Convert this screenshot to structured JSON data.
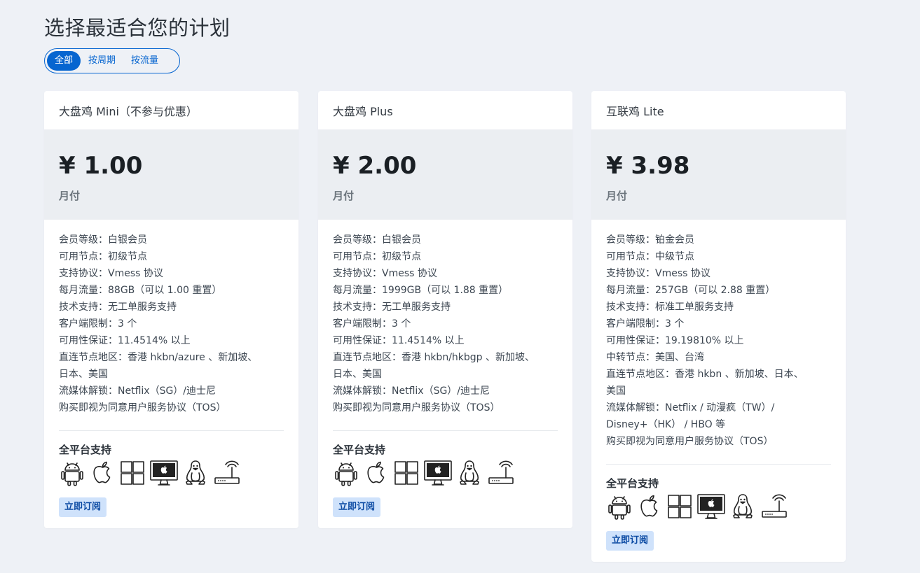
{
  "page": {
    "title": "选择最适合您的计划"
  },
  "filters": [
    {
      "label": "全部",
      "active": true
    },
    {
      "label": "按周期",
      "active": false
    },
    {
      "label": "按流量",
      "active": false
    }
  ],
  "platform_icons": [
    "android-icon",
    "apple-icon",
    "windows-icon",
    "macos-imac-icon",
    "linux-tux-icon",
    "router-icon"
  ],
  "plans": [
    {
      "name": "大盘鸡 Mini（不参与优惠）",
      "price": "¥ 1.00",
      "period": "月付",
      "features": [
        "会员等级：白银会员",
        "可用节点：初级节点",
        "支持协议：Vmess 协议",
        "每月流量：88GB（可以 1.00 重置）",
        "技术支持：无工单服务支持",
        "客户端限制：3 个",
        "可用性保证：11.4514% 以上",
        "直连节点地区：香港 hkbn/azure 、新加坡、",
        "日本、美国",
        "流媒体解锁：Netflix（SG）/迪士尼",
        "购买即视为同意用户服务协议（TOS）"
      ],
      "platform_title": "全平台支持",
      "subscribe_label": "立即订阅"
    },
    {
      "name": "大盘鸡 Plus",
      "price": "¥ 2.00",
      "period": "月付",
      "features": [
        "会员等级：白银会员",
        "可用节点：初级节点",
        "支持协议：Vmess 协议",
        "每月流量：1999GB（可以 1.88 重置）",
        "技术支持：无工单服务支持",
        "客户端限制：3 个",
        "可用性保证：11.4514% 以上",
        "直连节点地区：香港 hkbn/hkbgp 、新加坡、",
        "日本、美国",
        "流媒体解锁：Netflix（SG）/迪士尼",
        "购买即视为同意用户服务协议（TOS）"
      ],
      "platform_title": "全平台支持",
      "subscribe_label": "立即订阅"
    },
    {
      "name": "互联鸡 Lite",
      "price": "¥ 3.98",
      "period": "月付",
      "features": [
        "会员等级：铂金会员",
        "可用节点：中级节点",
        "支持协议：Vmess 协议",
        "每月流量：257GB（可以 2.88 重置）",
        "技术支持：标准工单服务支持",
        "客户端限制：3 个",
        "可用性保证：19.19810% 以上",
        "中转节点：美国、台湾",
        "直连节点地区：香港 hkbn 、新加坡、日本、",
        "美国",
        "流媒体解锁：Netflix / 动漫疯（TW）/",
        "Disney+（HK） / HBO 等",
        "购买即视为同意用户服务协议（TOS）"
      ],
      "platform_title": "全平台支持",
      "subscribe_label": "立即订阅"
    }
  ]
}
